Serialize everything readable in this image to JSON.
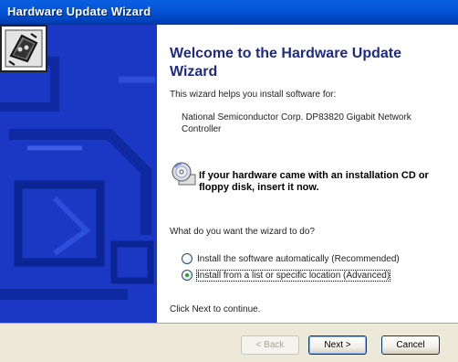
{
  "window": {
    "title": "Hardware Update Wizard"
  },
  "content": {
    "heading": "Welcome to the Hardware Update Wizard",
    "intro": "This wizard helps you install software for:",
    "device": "National Semiconductor Corp. DP83820 Gigabit Network Controller",
    "cd_prompt": "If your hardware came with an installation CD or floppy disk, insert it now.",
    "question": "What do you want the wizard to do?",
    "options": [
      {
        "label": "Install the software automatically (Recommended)",
        "selected": false
      },
      {
        "label": "Install from a list or specific location (Advanced)",
        "selected": true
      }
    ],
    "continue_hint": "Click Next to continue."
  },
  "buttons": {
    "back": "< Back",
    "next": "Next >",
    "cancel": "Cancel"
  },
  "colors": {
    "titlebar": "#0456d8",
    "side_panel": "#1a38c4",
    "heading": "#1f2a86",
    "button_bar": "#ece9d8"
  },
  "icons": {
    "side": "hardware-device-icon",
    "cd": "cd-disk-icon"
  }
}
